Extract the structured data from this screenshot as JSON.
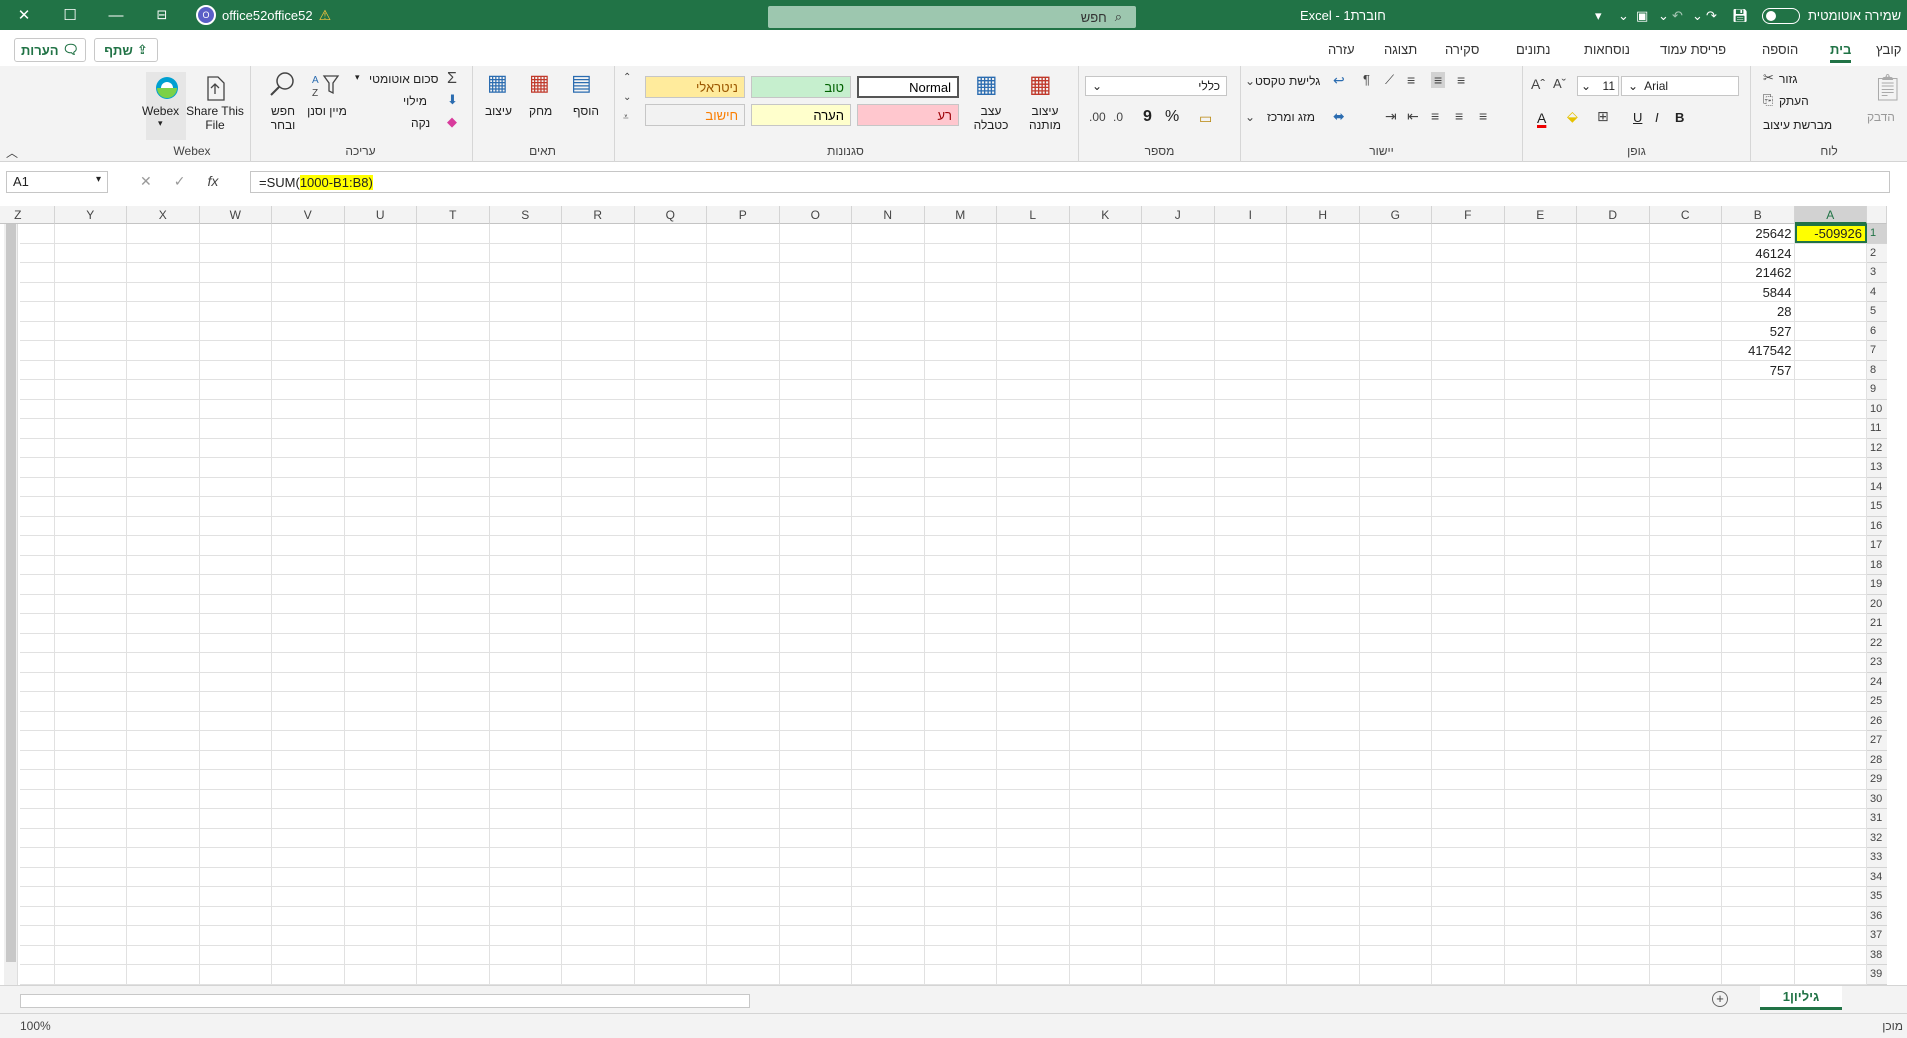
{
  "titlebar": {
    "account": "office52office52",
    "search_placeholder": "חפש",
    "doc_title": "Excel  -  חוברת1",
    "autosave_label": "שמירה אוטומטית"
  },
  "tabs": [
    "קובץ",
    "בית",
    "הוספה",
    "פריסת עמוד",
    "נוסחאות",
    "נתונים",
    "סקירה",
    "תצוגה",
    "עזרה"
  ],
  "active_tab": "בית",
  "share_label": "שתף",
  "comments_label": "הערות",
  "ribbon": {
    "clipboard": {
      "label": "לוח",
      "paste": "הדבק",
      "cut": "גזור",
      "copy": "העתק",
      "format_painter": "מברשת עיצוב"
    },
    "font": {
      "label": "גופן",
      "name": "Arial",
      "size": "11",
      "bold": "B",
      "italic": "I",
      "underline": "U"
    },
    "alignment": {
      "label": "יישור",
      "wrap": "גלישת טקסט",
      "merge": "מזג ומרכז"
    },
    "number": {
      "label": "מספר",
      "format": "כללי",
      "percent": "%",
      "comma": "9"
    },
    "styles": {
      "label": "סגנונות",
      "conditional": "עיצוב מותנה",
      "as_table": "עצב כטבלה",
      "cells": [
        {
          "text": "Normal",
          "bg": "#ffffff",
          "color": "#000000"
        },
        {
          "text": "טוב",
          "bg": "#c6efce",
          "color": "#006100"
        },
        {
          "text": "ניטראלי",
          "bg": "#ffeb9c",
          "color": "#9c5700"
        },
        {
          "text": "רע",
          "bg": "#ffc7ce",
          "color": "#9c0006"
        },
        {
          "text": "הערה",
          "bg": "#ffffcc",
          "color": "#000000"
        },
        {
          "text": "חישוב",
          "bg": "#f2f2f2",
          "color": "#fa7d00"
        }
      ]
    },
    "cells": {
      "label": "תאים",
      "insert": "הוסף",
      "delete": "מחק",
      "format": "עיצוב"
    },
    "editing": {
      "label": "עריכה",
      "autosum": "סכום אוטומטי",
      "fill": "מילוי",
      "clear": "נקה",
      "sort": "מיין וסנן",
      "find": "חפש ובחר"
    },
    "webex": {
      "label": "Webex",
      "webex": "Webex",
      "share": "Share This File"
    }
  },
  "formula_bar": {
    "namebox": "A1",
    "formula_prefix": "=SUM(",
    "formula_highlight": "1000-B1:B8)"
  },
  "columns": [
    "A",
    "B",
    "C",
    "D",
    "E",
    "F",
    "G",
    "H",
    "I",
    "J",
    "K",
    "L",
    "M",
    "N",
    "O",
    "P",
    "Q",
    "R",
    "S",
    "T",
    "U",
    "V",
    "W",
    "X",
    "Y",
    "Z"
  ],
  "cells": {
    "A1": "-509926",
    "B": [
      "25642",
      "46124",
      "21462",
      "5844",
      "28",
      "527",
      "417542",
      "757"
    ]
  },
  "sheet_tab": "גיליון1",
  "status": {
    "zoom": "100%",
    "ready": "מוכן"
  },
  "colors": {
    "accent": "#217346",
    "highlight": "#ffff00"
  }
}
